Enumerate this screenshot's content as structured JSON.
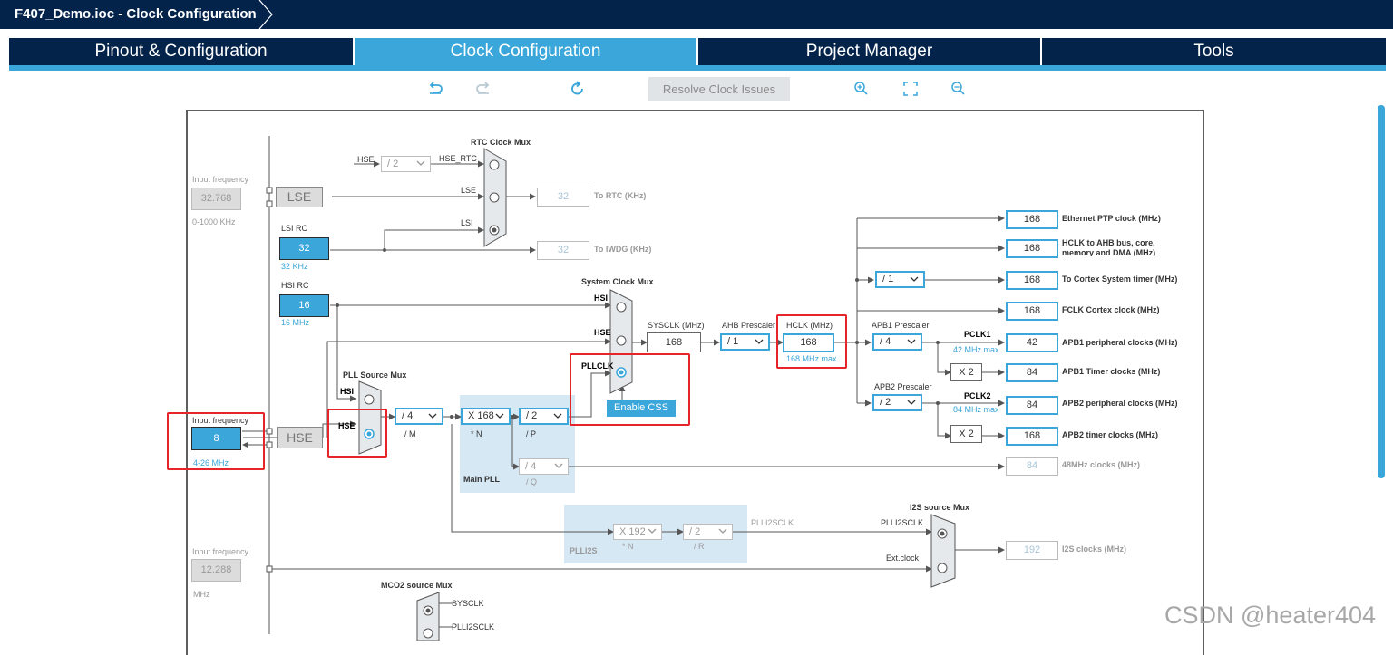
{
  "window": {
    "title": "F407_Demo.ioc - Clock Configuration"
  },
  "tabs": [
    {
      "label": "Pinout & Configuration"
    },
    {
      "label": "Clock Configuration"
    },
    {
      "label": "Project Manager"
    },
    {
      "label": "Tools"
    }
  ],
  "toolbar": {
    "icons": [
      "undo-icon",
      "redo-icon",
      "refresh-icon",
      "zoom-in-icon",
      "fit-screen-icon",
      "zoom-out-icon"
    ],
    "resolve_label": "Resolve Clock Issues"
  },
  "sources": {
    "lse": {
      "caption": "Input frequency",
      "value": "32.768",
      "range": "0-1000 KHz",
      "label": "LSE"
    },
    "lsi": {
      "caption": "LSI RC",
      "value": "32",
      "unit": "32 KHz"
    },
    "hsi": {
      "caption": "HSI RC",
      "value": "16",
      "unit": "16 MHz"
    },
    "hse": {
      "caption": "Input frequency",
      "value": "8",
      "range": "4-26 MHz",
      "label": "HSE"
    },
    "ext": {
      "caption": "Input frequency",
      "value": "12.288",
      "unit": "MHz"
    }
  },
  "rtc": {
    "title": "RTC Clock Mux",
    "hse_label": "HSE",
    "div": "/ 2",
    "hse_rtc": "HSE_RTC",
    "lse_label": "LSE",
    "lsi_label": "LSI",
    "out_value": "32",
    "out_label": "To RTC (KHz)",
    "iwdg_value": "32",
    "iwdg_label": "To IWDG (KHz)"
  },
  "pll": {
    "src_title": "PLL Source Mux",
    "hsi": "HSI",
    "hse": "HSE",
    "m_div": "/ 4",
    "m_label": "/ M",
    "n_mul": "X 168",
    "n_label": "* N",
    "p_div": "/ 2",
    "p_label": "/ P",
    "q_div": "/ 4",
    "q_label": "/ Q",
    "main_label": "Main PLL"
  },
  "sysmux": {
    "title": "System Clock Mux",
    "hsi": "HSI",
    "hse": "HSE",
    "pllclk": "PLLCLK",
    "css_label": "Enable CSS",
    "sysclk_label": "SYSCLK (MHz)",
    "sysclk_value": "168"
  },
  "ahb": {
    "label": "AHB Prescaler",
    "value": "/ 1",
    "hclk_label": "HCLK (MHz)",
    "hclk_value": "168",
    "hclk_max": "168 MHz max"
  },
  "apb1": {
    "label": "APB1 Prescaler",
    "value": "/ 4",
    "pclk": "PCLK1",
    "max": "42 MHz max"
  },
  "apb2": {
    "label": "APB2 Prescaler",
    "value": "/ 2",
    "pclk": "PCLK2",
    "max": "84 MHz max"
  },
  "cortex_div": "/ 1",
  "x2_label": "X 2",
  "outputs": [
    {
      "value": "168",
      "label": "Ethernet PTP clock (MHz)"
    },
    {
      "value": "168",
      "label": "HCLK to AHB bus, core,",
      "label2": "memory and DMA (MHz)"
    },
    {
      "value": "168",
      "label": "To Cortex System timer (MHz)"
    },
    {
      "value": "168",
      "label": "FCLK Cortex clock (MHz)"
    },
    {
      "value": "42",
      "label": "APB1 peripheral clocks (MHz)"
    },
    {
      "value": "84",
      "label": "APB1 Timer clocks (MHz)"
    },
    {
      "value": "84",
      "label": "APB2 peripheral clocks (MHz)"
    },
    {
      "value": "168",
      "label": "APB2 timer clocks (MHz)"
    },
    {
      "value": "84",
      "label": "48MHz clocks (MHz)"
    }
  ],
  "plli2s": {
    "n_mul": "X 192",
    "n_label": "* N",
    "r_div": "/ 2",
    "r_label": "/ R",
    "label": "PLLI2S",
    "clk_label": "PLLI2SCLK",
    "mux_title": "I2S source Mux",
    "mux_in1": "PLLI2SCLK",
    "mux_in2": "Ext.clock",
    "out_value": "192",
    "out_label": "I2S clocks (MHz)"
  },
  "mco2": {
    "title": "MCO2 source Mux",
    "in1": "SYSCLK",
    "in2": "PLLI2SCLK"
  },
  "watermark": "CSDN @heater404",
  "colors": {
    "title_bar": "#03234b",
    "accent": "#3aa6d9",
    "highlight": "#e8242b"
  }
}
